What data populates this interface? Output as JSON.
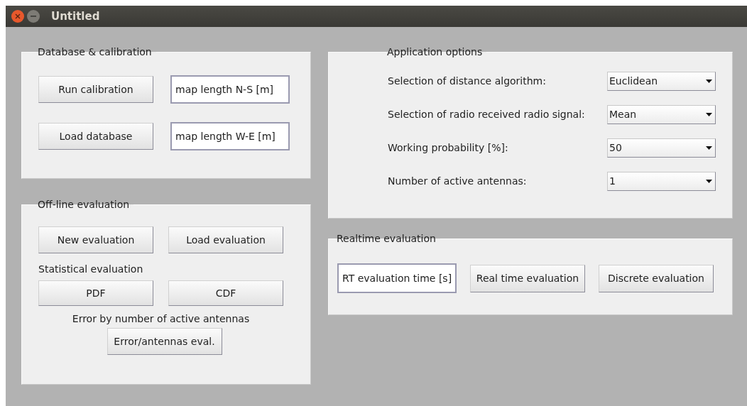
{
  "window": {
    "title": "Untitled"
  },
  "database_calibration": {
    "title": "Database & calibration",
    "rows": [
      {
        "button": "Run calibration",
        "field": "map length N-S [m]"
      },
      {
        "button": "Load database",
        "field": "map length W-E [m]"
      }
    ]
  },
  "offline_evaluation": {
    "title": "Off-line evaluation",
    "buttons": [
      "New evaluation",
      "Load evaluation"
    ],
    "statistical_label": "Statistical evaluation",
    "statistical_buttons": [
      "PDF",
      "CDF"
    ],
    "error_label": "Error by number of active antennas",
    "error_button": "Error/antennas eval."
  },
  "application_options": {
    "title": "Application options",
    "rows": [
      {
        "label": "Selection of distance algorithm:",
        "value": "Euclidean"
      },
      {
        "label": "Selection of radio received radio signal:",
        "value": "Mean"
      },
      {
        "label": "Working probability [%]:",
        "value": "50"
      },
      {
        "label": "Number of active antennas:",
        "value": "1"
      }
    ]
  },
  "realtime_evaluation": {
    "title": "Realtime evaluation",
    "field": "RT evaluation time [s]",
    "buttons": [
      "Real time evaluation",
      "Discrete evaluation"
    ]
  }
}
